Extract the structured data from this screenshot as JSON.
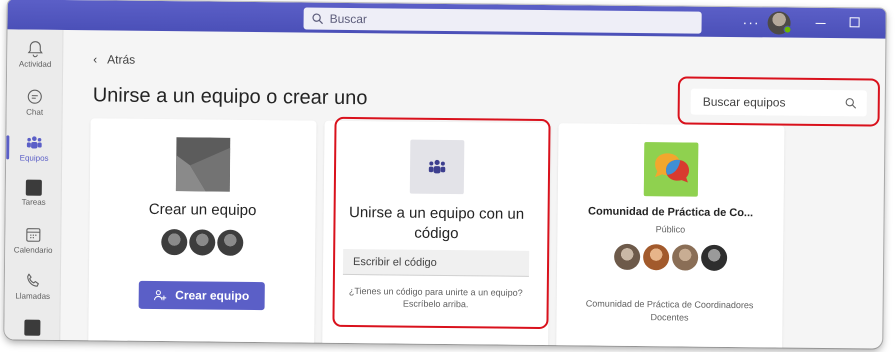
{
  "titlebar": {
    "search_placeholder": "Buscar",
    "more_label": "···"
  },
  "rail": {
    "items": [
      {
        "label": "Actividad"
      },
      {
        "label": "Chat"
      },
      {
        "label": "Equipos"
      },
      {
        "label": "Tareas"
      },
      {
        "label": "Calendario"
      },
      {
        "label": "Llamadas"
      }
    ]
  },
  "main": {
    "back_label": "Atrás",
    "title": "Unirse a un equipo o crear uno",
    "team_search_placeholder": "Buscar equipos"
  },
  "cards": {
    "create": {
      "title": "Crear un equipo",
      "button_label": "Crear equipo"
    },
    "join": {
      "title": "Unirse a un equipo con un código",
      "input_placeholder": "Escribir el código",
      "help": "¿Tienes un código para unirte a un equipo? Escríbelo arriba."
    },
    "community": {
      "title": "Comunidad de Práctica de Co...",
      "visibility": "Público",
      "description": "Comunidad de Práctica de Coordinadores Docentes"
    }
  },
  "colors": {
    "brand": "#5b5fc7",
    "highlight": "#d9111c",
    "community_tile": "#8fd14f"
  }
}
